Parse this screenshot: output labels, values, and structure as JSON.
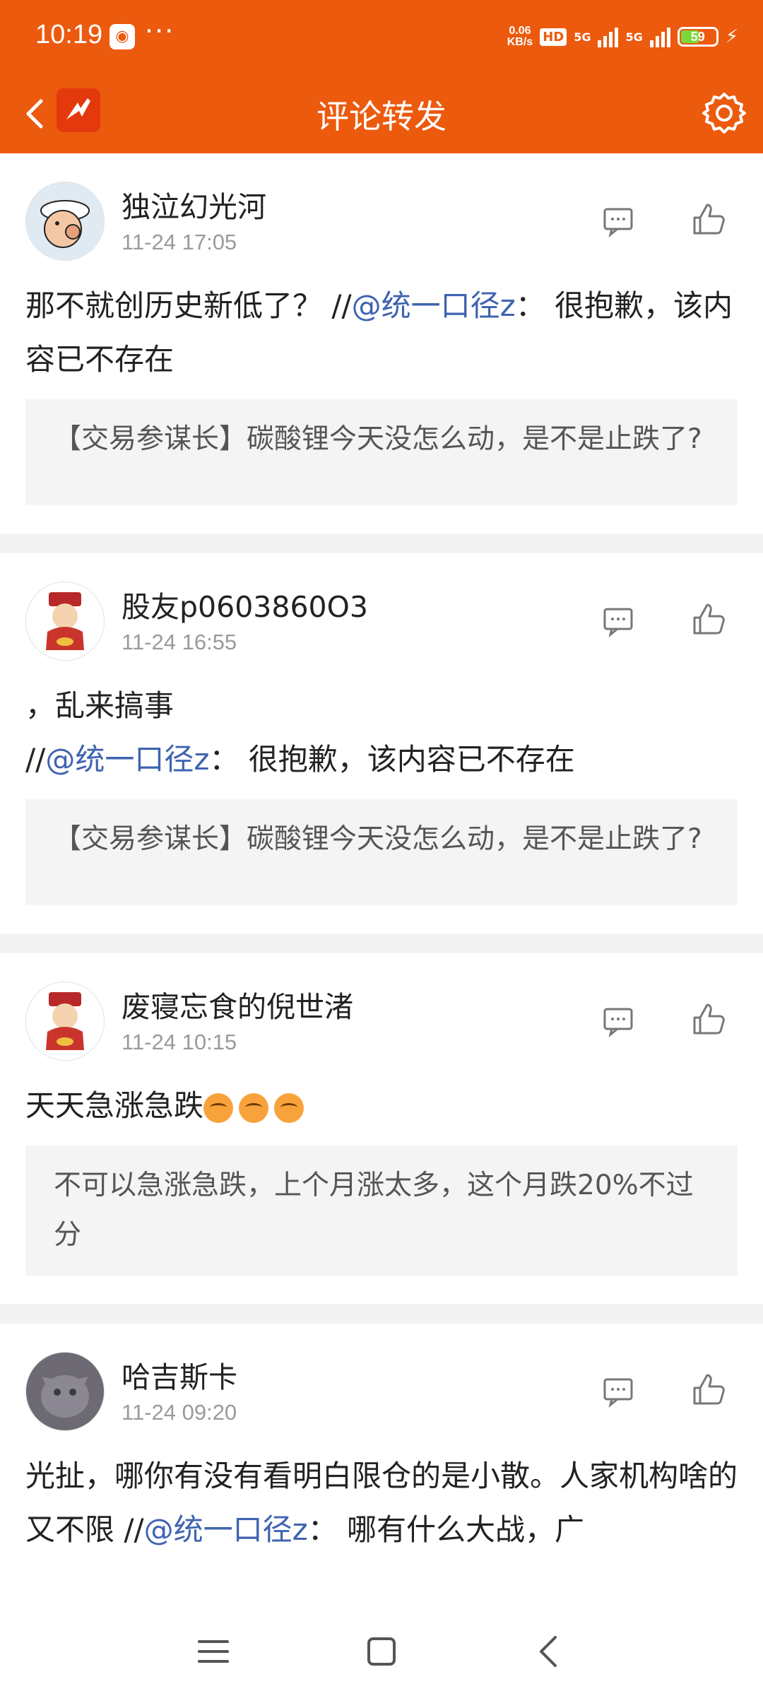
{
  "status_bar": {
    "time": "10:19",
    "more": "···",
    "speed_top": "0.06",
    "speed_bottom": "KB/s",
    "hd": "HD",
    "net1": "5G",
    "net2": "5G",
    "battery": "59",
    "battery_level": 0.59
  },
  "header": {
    "title": "评论转发"
  },
  "colors": {
    "brand": "#ec5a0e",
    "mention": "#3f63b0"
  },
  "posts": [
    {
      "username": "独泣幻光河",
      "time": "11-24 17:05",
      "text_before": "那不就创历史新低了？ //",
      "mention": "@统一口径z",
      "text_after": "： 很抱歉，该内容已不存在",
      "quote": "【交易参谋长】碳酸锂今天没怎么动，是不是止跌了?"
    },
    {
      "username": "股友p0603860O3",
      "time": "11-24 16:55",
      "text_line1": "，乱来搞事",
      "text_before": " //",
      "mention": "@统一口径z",
      "text_after": "： 很抱歉，该内容已不存在",
      "quote": "【交易参谋长】碳酸锂今天没怎么动，是不是止跌了?"
    },
    {
      "username": "废寝忘食的倪世渚",
      "time": "11-24 10:15",
      "text": "天天急涨急跌",
      "quote": "不可以急涨急跌，上个月涨太多，这个月跌20%不过分"
    },
    {
      "username": "哈吉斯卡",
      "time": "11-24 09:20",
      "text_before": "光扯，哪你有没有看明白限仓的是小散。人家机构啥的又不限 //",
      "mention": "@统一口径z",
      "text_after": "： 哪有什么大战，广"
    }
  ]
}
